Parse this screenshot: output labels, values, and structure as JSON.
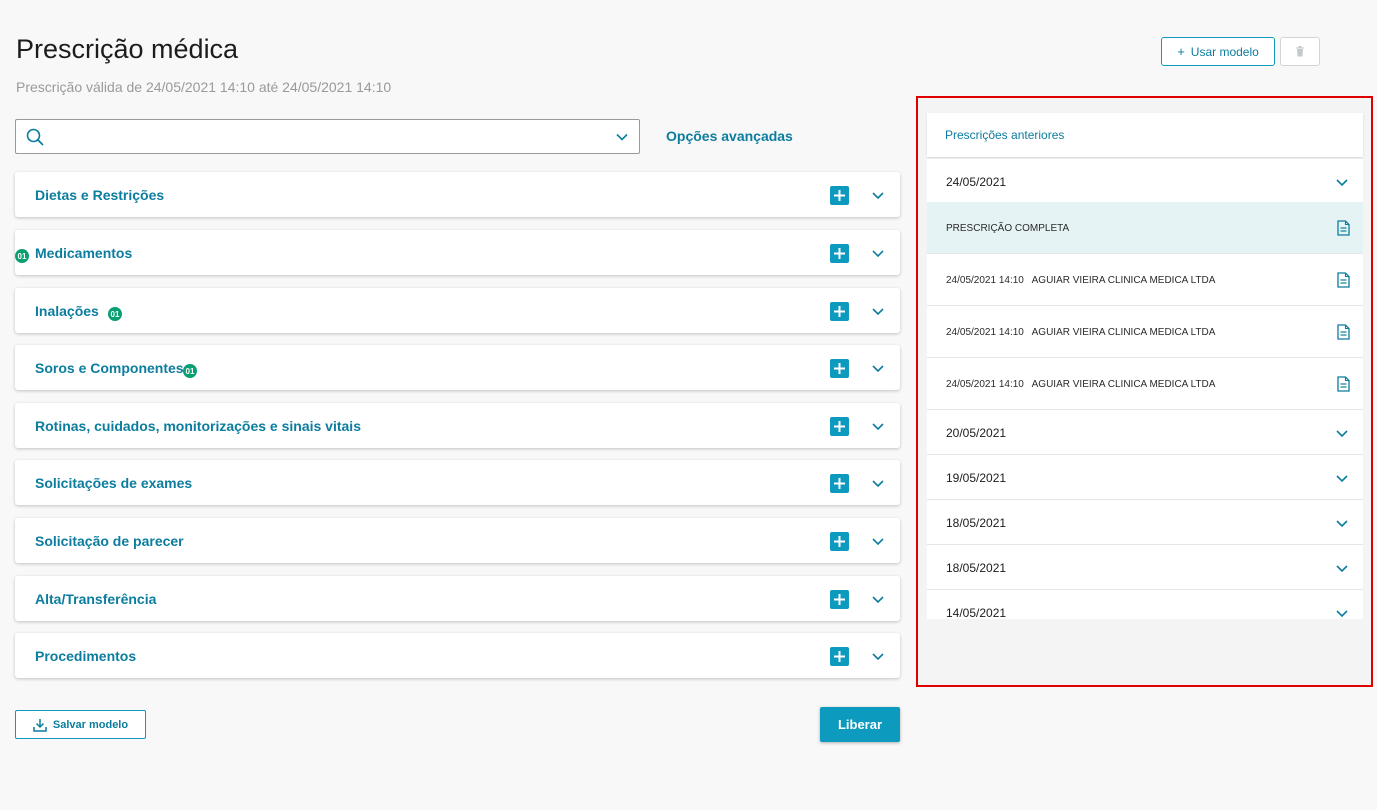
{
  "page": {
    "title": "Prescrição médica",
    "subtitle": "Prescrição válida de 24/05/2021 14:10 até 24/05/2021 14:10"
  },
  "toolbar": {
    "use_model_icon": "+",
    "use_model_label": "Usar modelo",
    "delete_icon": "trash-icon"
  },
  "search": {
    "value": "",
    "placeholder": "",
    "advanced_options": "Opções avançadas"
  },
  "sections": [
    {
      "label": "Dietas e Restrições",
      "badge": ""
    },
    {
      "label": "Medicamentos",
      "badge": "01"
    },
    {
      "label": "Inalações",
      "badge": "01"
    },
    {
      "label": "Soros e Componentes",
      "badge": "01"
    },
    {
      "label": "Rotinas, cuidados, monitorizações e sinais vitais",
      "badge": ""
    },
    {
      "label": "Solicitações de exames",
      "badge": ""
    },
    {
      "label": "Solicitação de parecer",
      "badge": ""
    },
    {
      "label": "Alta/Transferência",
      "badge": ""
    },
    {
      "label": "Procedimentos",
      "badge": ""
    }
  ],
  "footer": {
    "save_model_label": "Salvar modelo",
    "release_label": "Liberar"
  },
  "previous": {
    "title": "Prescrições anteriores",
    "rows": [
      {
        "type": "date",
        "text": "24/05/2021"
      },
      {
        "type": "sub",
        "text": "PRESCRIÇÃO COMPLETA"
      },
      {
        "type": "sub",
        "text": "24/05/2021 14:10   AGUIAR VIEIRA CLINICA MEDICA LTDA"
      },
      {
        "type": "sub",
        "text": "24/05/2021 14:10   AGUIAR VIEIRA CLINICA MEDICA LTDA"
      },
      {
        "type": "sub",
        "text": "24/05/2021 14:10   AGUIAR VIEIRA CLINICA MEDICA LTDA"
      },
      {
        "type": "date",
        "text": "20/05/2021"
      },
      {
        "type": "date",
        "text": "19/05/2021"
      },
      {
        "type": "date",
        "text": "18/05/2021"
      },
      {
        "type": "date",
        "text": "18/05/2021"
      },
      {
        "type": "date",
        "text": "14/05/2021"
      }
    ]
  },
  "colors": {
    "accent": "#0c9abe",
    "link": "#0c7d9e",
    "badge": "#0a9f72",
    "highlight_row": "#e6f3f4",
    "annotation_border": "#e00000"
  }
}
